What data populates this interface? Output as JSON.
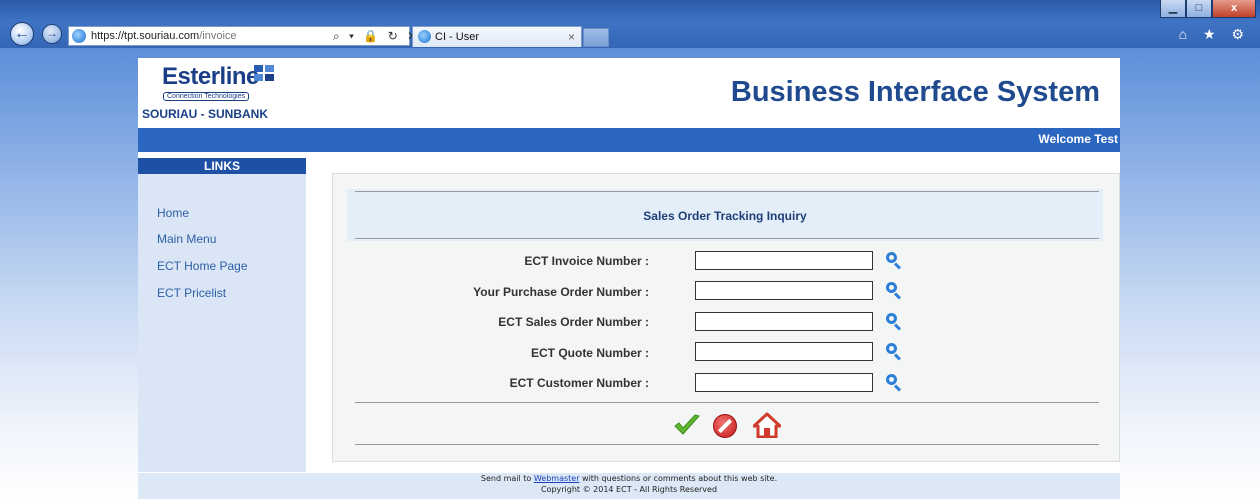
{
  "browser": {
    "url_host": "https://tpt.souriau.com",
    "url_path": "/invoice",
    "tab_title": "CI - User",
    "tab_close": "×",
    "back_glyph": "←",
    "forward_glyph": "→",
    "address_tools": "⌕ ▾ 🔒 ↻ ✕",
    "right_icons": "⌂ ★ ⚙",
    "min_glyph": "▁",
    "max_glyph": "□",
    "close_glyph": "x"
  },
  "header": {
    "logo_text": "Esterline",
    "logo_subtitle": "Connection Technologies",
    "brand": "SOURIAU - SUNBANK",
    "title": "Business Interface System",
    "welcome": "Welcome Test"
  },
  "links": {
    "heading": "LINKS",
    "items": [
      {
        "label": "Home"
      },
      {
        "label": "Main Menu"
      },
      {
        "label": "ECT Home Page"
      },
      {
        "label": "ECT Pricelist"
      }
    ]
  },
  "form": {
    "title": "Sales Order Tracking Inquiry",
    "fields": [
      {
        "label": "ECT Invoice Number :",
        "value": ""
      },
      {
        "label": "Your Purchase Order Number :",
        "value": ""
      },
      {
        "label": "ECT Sales Order Number :",
        "value": ""
      },
      {
        "label": "ECT Quote Number :",
        "value": ""
      },
      {
        "label": "ECT Customer Number :",
        "value": ""
      }
    ]
  },
  "footer": {
    "line1_prefix": "Send mail to",
    "webmaster": "Webmaster",
    "line1_suffix": "with questions or comments about this web site.",
    "line2": "Copyright © 2014 ECT - All Rights Reserved"
  },
  "colors": {
    "accent_blue": "#2b66c0",
    "title_blue": "#1f4a8e",
    "confirm_green": "#5fb830",
    "cancel_red": "#c61a1a",
    "home_red": "#d03a2a"
  }
}
